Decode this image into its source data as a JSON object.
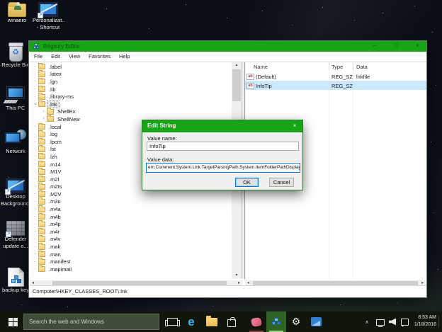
{
  "desktop": {
    "icons": [
      {
        "id": "winaero",
        "line1": "winaero",
        "line2": ""
      },
      {
        "id": "personalization-shortcut",
        "line1": "Personalizat...",
        "line2": "- Shortcut"
      },
      {
        "id": "recycle-bin",
        "line1": "Recycle Bin",
        "line2": ""
      },
      {
        "id": "this-pc",
        "line1": "This PC",
        "line2": ""
      },
      {
        "id": "network",
        "line1": "Network",
        "line2": ""
      },
      {
        "id": "desktop-background",
        "line1": "Desktop",
        "line2": "Background"
      },
      {
        "id": "defender-update",
        "line1": "Defender",
        "line2": "update a..."
      },
      {
        "id": "backup-key",
        "line1": "backup key",
        "line2": ""
      }
    ]
  },
  "registry_editor": {
    "title": "Registry Editor",
    "caption_buttons": {
      "minimize": "–",
      "maximize": "□",
      "close": "×"
    },
    "menu_items": [
      "File",
      "Edit",
      "View",
      "Favorites",
      "Help"
    ],
    "tree_items": [
      {
        "label": ".label",
        "level": 0,
        "state": "none",
        "selected": false
      },
      {
        "label": ".latex",
        "level": 0,
        "state": "none",
        "selected": false
      },
      {
        "label": ".lgn",
        "level": 0,
        "state": "none",
        "selected": false
      },
      {
        "label": ".lib",
        "level": 0,
        "state": "none",
        "selected": false
      },
      {
        "label": ".library-ms",
        "level": 0,
        "state": "none",
        "selected": false
      },
      {
        "label": ".lnk",
        "level": 0,
        "state": "expanded",
        "selected": true
      },
      {
        "label": "ShellEx",
        "level": 1,
        "state": "collapsed",
        "selected": false
      },
      {
        "label": "ShellNew",
        "level": 1,
        "state": "collapsed",
        "selected": false
      },
      {
        "label": ".local",
        "level": 0,
        "state": "none",
        "selected": false
      },
      {
        "label": ".log",
        "level": 0,
        "state": "none",
        "selected": false
      },
      {
        "label": ".lpcm",
        "level": 0,
        "state": "none",
        "selected": false
      },
      {
        "label": ".lst",
        "level": 0,
        "state": "none",
        "selected": false
      },
      {
        "label": ".lzh",
        "level": 0,
        "state": "none",
        "selected": false
      },
      {
        "label": ".m14",
        "level": 0,
        "state": "none",
        "selected": false
      },
      {
        "label": ".M1V",
        "level": 0,
        "state": "none",
        "selected": false
      },
      {
        "label": ".m2t",
        "level": 0,
        "state": "none",
        "selected": false
      },
      {
        "label": ".m2ts",
        "level": 0,
        "state": "none",
        "selected": false
      },
      {
        "label": ".M2V",
        "level": 0,
        "state": "none",
        "selected": false
      },
      {
        "label": ".m3u",
        "level": 0,
        "state": "none",
        "selected": false
      },
      {
        "label": ".m4a",
        "level": 0,
        "state": "none",
        "selected": false
      },
      {
        "label": ".m4b",
        "level": 0,
        "state": "none",
        "selected": false
      },
      {
        "label": ".m4p",
        "level": 0,
        "state": "none",
        "selected": false
      },
      {
        "label": ".m4r",
        "level": 0,
        "state": "none",
        "selected": false
      },
      {
        "label": ".m4v",
        "level": 0,
        "state": "none",
        "selected": false
      },
      {
        "label": ".mak",
        "level": 0,
        "state": "none",
        "selected": false
      },
      {
        "label": ".man",
        "level": 0,
        "state": "none",
        "selected": false
      },
      {
        "label": ".manifest",
        "level": 0,
        "state": "none",
        "selected": false
      },
      {
        "label": ".mapimail",
        "level": 0,
        "state": "none",
        "selected": false
      }
    ],
    "list": {
      "columns": [
        "Name",
        "Type",
        "Data"
      ],
      "value_icon_glyph": "ab",
      "rows": [
        {
          "name": "(Default)",
          "type": "REG_SZ",
          "data": "lnkfile",
          "selected": false
        },
        {
          "name": "InfoTip",
          "type": "REG_SZ",
          "data": "",
          "selected": true
        }
      ]
    },
    "status_bar": "Computer\\HKEY_CLASSES_ROOT\\.lnk"
  },
  "edit_dialog": {
    "title": "Edit String",
    "close": "×",
    "value_name_label": "Value name:",
    "value_name": "InfoTip",
    "value_data_label": "Value data:",
    "value_data": "em.Comment;System.Link.TargetParsingPath;System.ItemFolderPathDisplay",
    "ok_label": "OK",
    "cancel_label": "Cancel"
  },
  "taskbar": {
    "search_placeholder": "Search the web and Windows",
    "tray_chevron": "∧",
    "clock": {
      "time": "8:53 AM",
      "date": "1/18/2016"
    }
  },
  "colors": {
    "accent_green": "#17a417",
    "selection_blue": "#cce8ff",
    "taskbar_bg": "#11160c"
  }
}
